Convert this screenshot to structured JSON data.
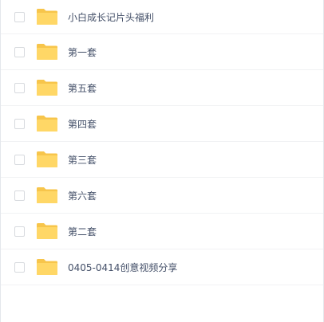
{
  "colors": {
    "folder_back": "#f7c54b",
    "folder_front": "#ffd766",
    "text": "#424e67",
    "checkbox_border": "#d7dade",
    "divider": "#f1f2f4"
  },
  "files": [
    {
      "name": "小白成长记片头福利",
      "icon": "folder-icon",
      "checked": false
    },
    {
      "name": "第一套",
      "icon": "folder-icon",
      "checked": false
    },
    {
      "name": "第五套",
      "icon": "folder-icon",
      "checked": false
    },
    {
      "name": "第四套",
      "icon": "folder-icon",
      "checked": false
    },
    {
      "name": "第三套",
      "icon": "folder-icon",
      "checked": false
    },
    {
      "name": "第六套",
      "icon": "folder-icon",
      "checked": false
    },
    {
      "name": "第二套",
      "icon": "folder-icon",
      "checked": false
    },
    {
      "name": "0405-0414创意视频分享",
      "icon": "folder-icon",
      "checked": false
    }
  ]
}
